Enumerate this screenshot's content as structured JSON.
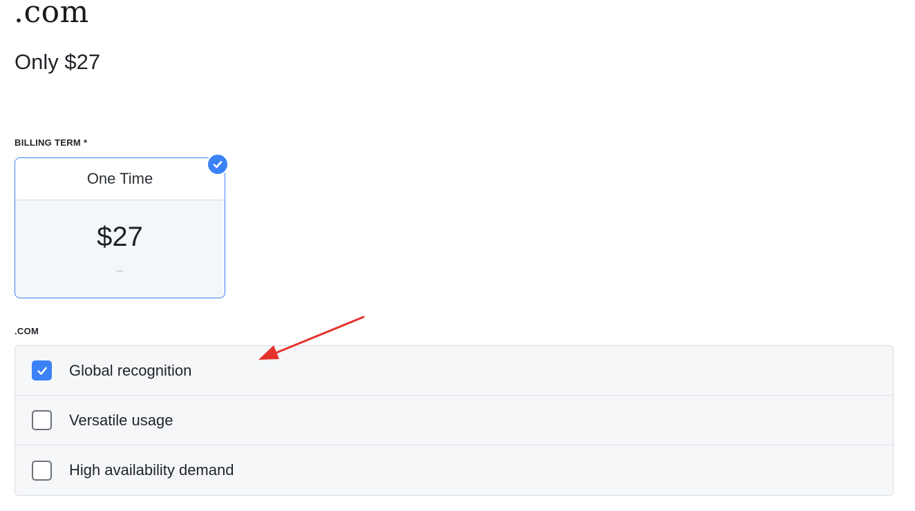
{
  "product": {
    "title": ".com",
    "subtitle": "Only $27"
  },
  "billing": {
    "label": "BILLING TERM *",
    "option": {
      "name": "One Time",
      "price": "$27",
      "note": "–",
      "selected": true
    }
  },
  "extension": {
    "label": ".COM",
    "options": [
      {
        "label": "Global recognition",
        "checked": true
      },
      {
        "label": "Versatile usage",
        "checked": false
      },
      {
        "label": "High availability demand",
        "checked": false
      }
    ]
  },
  "colors": {
    "accent": "#3b82f6",
    "annotation": "#e5322d"
  },
  "icons": {
    "selected_badge": "check-circle-icon",
    "checkbox_check": "checkmark-icon",
    "annotation": "arrow-icon"
  }
}
